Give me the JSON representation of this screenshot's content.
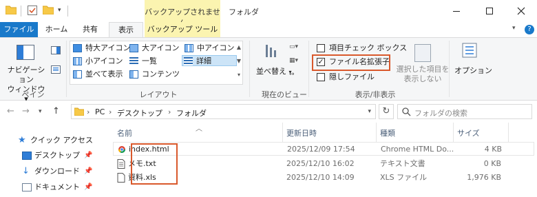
{
  "titlebar": {
    "context_tab_title": "バックアップされません",
    "window_title": "フォルダ"
  },
  "tabs": {
    "file": "ファイル",
    "home": "ホーム",
    "share": "共有",
    "view": "表示",
    "backup_tools": "バックアップ ツール"
  },
  "ribbon": {
    "pane": {
      "nav_pane_line1": "ナビゲーション",
      "nav_pane_line2": "ウィンドウ ▾",
      "group_label": "ペイン"
    },
    "layout": {
      "items": [
        {
          "label": "特大アイコン",
          "icon": "extra-large-icons-icon"
        },
        {
          "label": "大アイコン",
          "icon": "large-icons-icon"
        },
        {
          "label": "中アイコン",
          "icon": "medium-icons-icon"
        },
        {
          "label": "小アイコン",
          "icon": "small-icons-icon"
        },
        {
          "label": "一覧",
          "icon": "list-icon"
        },
        {
          "label": "詳細",
          "icon": "details-icon",
          "selected": true
        },
        {
          "label": "並べて表示",
          "icon": "tiles-icon"
        },
        {
          "label": "コンテンツ",
          "icon": "content-icon"
        }
      ],
      "group_label": "レイアウト"
    },
    "current_view": {
      "sort_label": "並べ替え",
      "group_label": "現在のビュー"
    },
    "show_hide": {
      "item_checkboxes": "項目チェック ボックス",
      "item_checkboxes_checked": false,
      "file_extensions": "ファイル名拡張子",
      "file_extensions_checked": true,
      "hidden_items": "隠しファイル",
      "hidden_items_checked": false,
      "hide_selected_line1": "選択した項目を",
      "hide_selected_line2": "表示しない",
      "group_label": "表示/非表示"
    },
    "options_label": "オプション"
  },
  "address": {
    "crumbs": [
      "PC",
      "デスクトップ",
      "フォルダ"
    ],
    "search_placeholder": "フォルダの検索"
  },
  "navpane": {
    "items": [
      {
        "label": "クイック アクセス",
        "icon": "star-icon"
      },
      {
        "label": "デスクトップ",
        "icon": "desktop-icon",
        "pinned": true
      },
      {
        "label": "ダウンロード",
        "icon": "download-icon",
        "pinned": true
      },
      {
        "label": "ドキュメント",
        "icon": "documents-icon",
        "pinned": true
      }
    ]
  },
  "filelist": {
    "columns": [
      "名前",
      "更新日時",
      "種類",
      "サイズ"
    ],
    "rows": [
      {
        "name": "index.html",
        "modified": "2025/12/09 17:54",
        "type": "Chrome HTML Do...",
        "size": "4 KB",
        "icon": "chrome-html-icon"
      },
      {
        "name": "メモ.txt",
        "modified": "2025/12/10 16:02",
        "type": "テキスト文書",
        "size": "0 KB",
        "icon": "text-file-icon"
      },
      {
        "name": "資料.xls",
        "modified": "2025/12/10 14:09",
        "type": "XLS ファイル",
        "size": "1,976 KB",
        "icon": "xls-file-icon"
      }
    ]
  },
  "colors": {
    "accent": "#1979ca",
    "context_tab": "#fbf4b0",
    "highlight_box": "#d9582b",
    "selected_item": "#cce4f7"
  }
}
